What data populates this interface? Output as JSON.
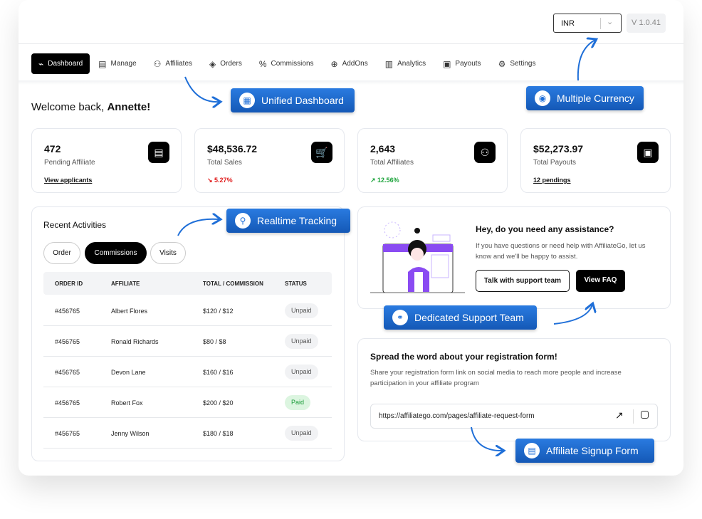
{
  "header": {
    "currency": "INR",
    "version": "V 1.0.41"
  },
  "nav": [
    {
      "label": "Dashboard",
      "icon": "chart-icon",
      "active": true
    },
    {
      "label": "Manage",
      "icon": "clipboard-icon"
    },
    {
      "label": "Affiliates",
      "icon": "users-icon"
    },
    {
      "label": "Orders",
      "icon": "box-icon"
    },
    {
      "label": "Commissions",
      "icon": "percent-icon"
    },
    {
      "label": "AddOns",
      "icon": "puzzle-icon"
    },
    {
      "label": "Analytics",
      "icon": "bar-chart-icon"
    },
    {
      "label": "Payouts",
      "icon": "cash-icon"
    },
    {
      "label": "Settings",
      "icon": "gear-icon"
    }
  ],
  "welcome": {
    "prefix": "Welcome back, ",
    "name": "Annette!"
  },
  "stats": [
    {
      "value": "472",
      "label": "Pending Affiliate",
      "footer": "View applicants",
      "icon": "document-icon"
    },
    {
      "value": "$48,536.72",
      "label": "Total Sales",
      "footer": "5.27%",
      "trend": "down",
      "trend_color": "#e01b1b",
      "icon": "cart-icon"
    },
    {
      "value": "2,643",
      "label": "Total Affiliates",
      "footer": "12.56%",
      "trend": "up",
      "trend_color": "#1ba33a",
      "icon": "users-icon"
    },
    {
      "value": "$52,273.97",
      "label": "Total Payouts",
      "footer": "12 pendings",
      "icon": "cash-icon"
    }
  ],
  "activities": {
    "title": "Recent Activities",
    "tabs": [
      "Order",
      "Commissions",
      "Visits"
    ],
    "active_tab": "Commissions",
    "columns": [
      "ORDER ID",
      "AFFILIATE",
      "TOTAL / COMMISSION",
      "STATUS"
    ],
    "rows": [
      [
        "#456765",
        "Albert Flores",
        "$120 / $12",
        "Unpaid"
      ],
      [
        "#456765",
        "Ronald Richards",
        "$80 / $8",
        "Unpaid"
      ],
      [
        "#456765",
        "Devon Lane",
        "$160 / $16",
        "Unpaid"
      ],
      [
        "#456765",
        "Robert Fox",
        "$200 / $20",
        "Paid"
      ],
      [
        "#456765",
        "Jenny Wilson",
        "$180 / $18",
        "Unpaid"
      ]
    ]
  },
  "support": {
    "title": "Hey, do you need any assistance?",
    "text": "If you have questions or need help with AffiliateGo, let us know and we'll be happy to assist.",
    "talk": "Talk with support team",
    "faq": "View FAQ"
  },
  "register": {
    "title": "Spread the word about your registration form!",
    "text": "Share your registration form link on social media to reach more people and increase participation in your affiliate program",
    "url": "https://affiliatego.com/pages/affiliate-request-form"
  },
  "callouts": {
    "unified": "Unified Dashboard",
    "currency": "Multiple Currency",
    "tracking": "Realtime Tracking",
    "support": "Dedicated Support Team",
    "signup": "Affiliate Signup Form"
  },
  "colors": {
    "accent": "#1f6fd8",
    "primary": "#000000"
  }
}
